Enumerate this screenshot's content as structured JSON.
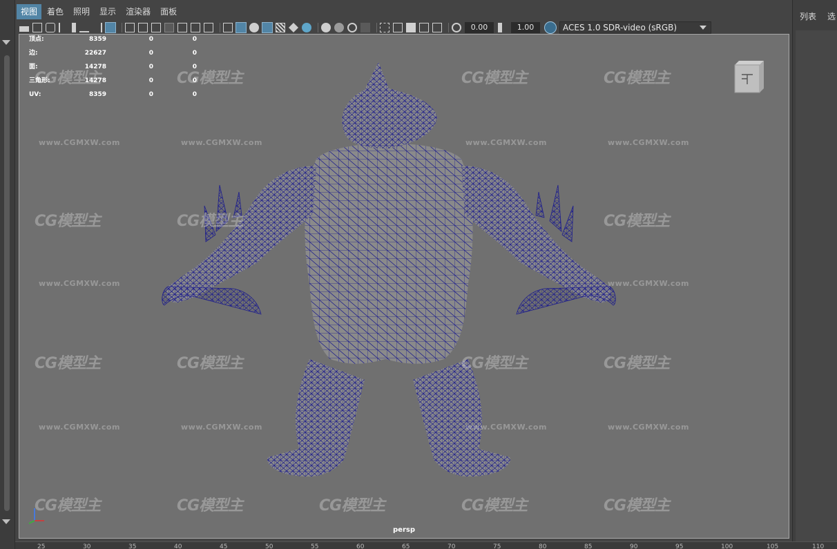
{
  "menubar": {
    "items": [
      "视图",
      "着色",
      "照明",
      "显示",
      "渲染器",
      "面板"
    ],
    "active_index": 0
  },
  "toolbar": {
    "exposure_value": "0.00",
    "gamma_value": "1.00",
    "color_space": "ACES 1.0 SDR-video (sRGB)"
  },
  "stats": {
    "rows": [
      {
        "label": "顶点:",
        "v1": "8359",
        "v2": "0",
        "v3": "0"
      },
      {
        "label": "边:",
        "v1": "22627",
        "v2": "0",
        "v3": "0"
      },
      {
        "label": "面:",
        "v1": "14278",
        "v2": "0",
        "v3": "0"
      },
      {
        "label": "三角形:",
        "v1": "14278",
        "v2": "0",
        "v3": "0"
      },
      {
        "label": "UV:",
        "v1": "8359",
        "v2": "0",
        "v3": "0"
      }
    ]
  },
  "viewport": {
    "camera_label": "persp",
    "wireframe_color": "#1e1e8c",
    "background_color": "#707070"
  },
  "right_panel": {
    "tab1": "列表",
    "tab2": "选"
  },
  "watermark": {
    "logo": "CG模型主",
    "url": "www.CGMXW.com"
  },
  "ruler": {
    "ticks": [
      "25",
      "30",
      "35",
      "40",
      "45",
      "50",
      "55",
      "60",
      "65",
      "70",
      "75",
      "80",
      "85",
      "90",
      "95",
      "100",
      "105",
      "110"
    ]
  },
  "colors": {
    "accent": "#5285a6",
    "panel_bg": "#444444"
  }
}
